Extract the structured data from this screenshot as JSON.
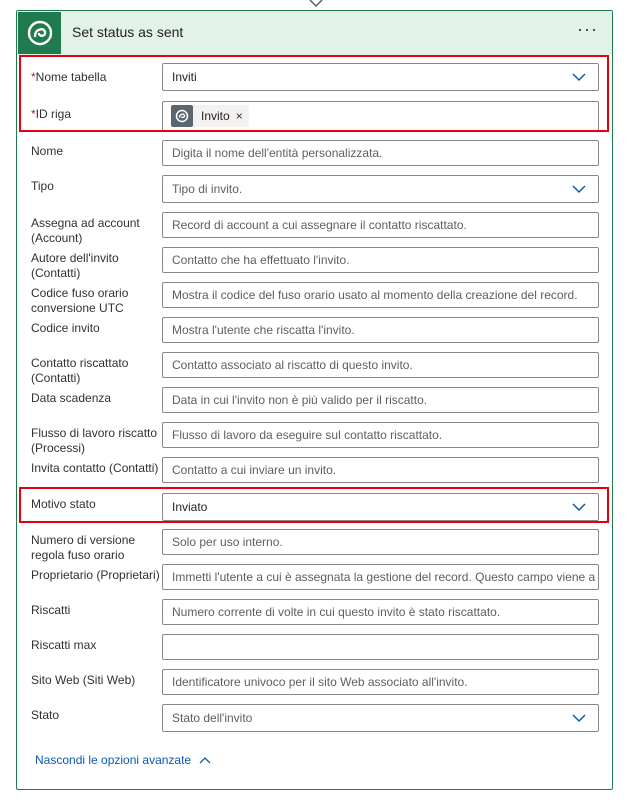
{
  "card": {
    "title": "Set status as sent",
    "more_label": "···"
  },
  "fields": {
    "nome_tabella": {
      "label": "Nome tabella",
      "required_mark": "*",
      "value": "Inviti"
    },
    "id_riga": {
      "label": "ID riga",
      "required_mark": "*",
      "token": "Invito",
      "remove": "×"
    },
    "nome": {
      "label": "Nome",
      "placeholder": "Digita il nome dell'entità personalizzata."
    },
    "tipo": {
      "label": "Tipo",
      "placeholder": "Tipo di invito."
    },
    "assegna": {
      "label": "Assegna ad account (Account)",
      "placeholder": "Record di account a cui assegnare il contatto riscattato."
    },
    "autore": {
      "label": "Autore dell'invito (Contatti)",
      "placeholder": "Contatto che ha effettuato l'invito."
    },
    "codice_fuso": {
      "label": "Codice fuso orario conversione UTC",
      "placeholder": "Mostra il codice del fuso orario usato al momento della creazione del record."
    },
    "codice_invito": {
      "label": "Codice invito",
      "placeholder": "Mostra l'utente che riscatta l'invito."
    },
    "contatto_riscattato": {
      "label": "Contatto riscattato (Contatti)",
      "placeholder": "Contatto associato al riscatto di questo invito."
    },
    "data_scadenza": {
      "label": "Data scadenza",
      "placeholder": "Data in cui l'invito non è più valido per il riscatto."
    },
    "flusso": {
      "label": "Flusso di lavoro riscatto (Processi)",
      "placeholder": "Flusso di lavoro da eseguire sul contatto riscattato."
    },
    "invita_contatto": {
      "label": "Invita contatto (Contatti)",
      "placeholder": "Contatto a cui inviare un invito."
    },
    "motivo_stato": {
      "label": "Motivo stato",
      "value": "Inviato"
    },
    "numero_versione": {
      "label": "Numero di versione regola fuso orario",
      "placeholder": "Solo per uso interno."
    },
    "proprietario": {
      "label": "Proprietario (Proprietari)",
      "placeholder": "Immetti l'utente a cui è assegnata la gestione del record. Questo campo viene a"
    },
    "riscatti": {
      "label": "Riscatti",
      "placeholder": "Numero corrente di volte in cui questo invito è stato riscattato."
    },
    "riscatti_max": {
      "label": "Riscatti max",
      "placeholder": ""
    },
    "sito_web": {
      "label": "Sito Web (Siti Web)",
      "placeholder": "Identificatore univoco per il sito Web associato all'invito."
    },
    "stato": {
      "label": "Stato",
      "placeholder": "Stato dell'invito"
    }
  },
  "advanced_toggle": "Nascondi le opzioni avanzate",
  "colors": {
    "accent_green": "#1f7a4d",
    "header_bg": "#e3f2e9",
    "highlight_red": "#e3000f",
    "link_blue": "#0a5ab0"
  }
}
